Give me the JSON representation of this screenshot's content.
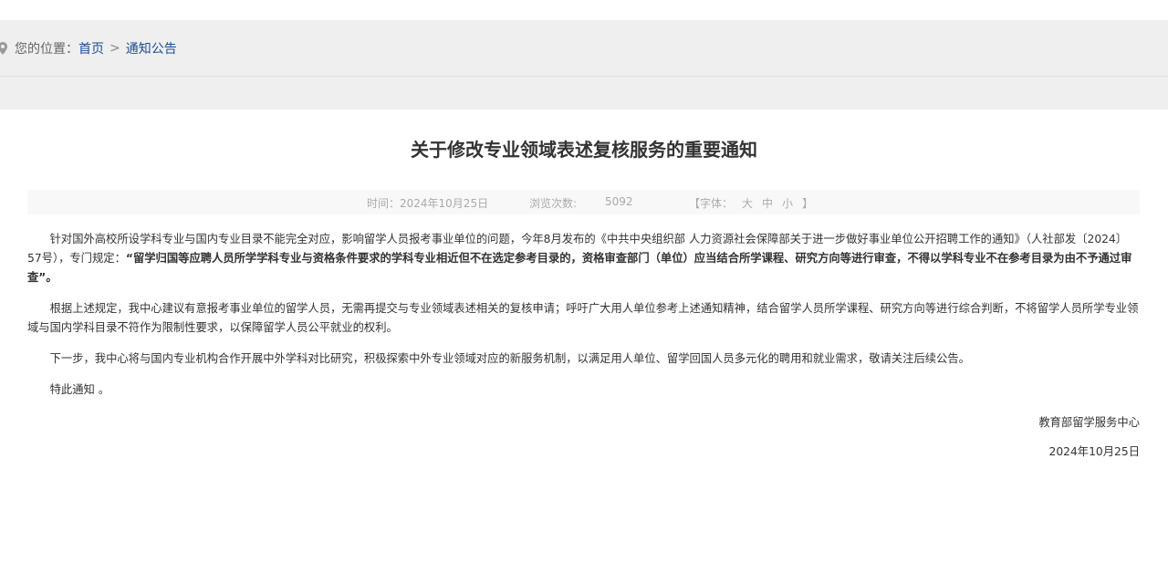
{
  "breadcrumb": {
    "prefix": "您的位置：",
    "home": "首页",
    "separator": ">",
    "current": "通知公告"
  },
  "icons": {
    "location": "location-pin-icon"
  },
  "article": {
    "title": "关于修改专业领域表述复核服务的重要通知",
    "meta": {
      "time": "时间：2024年10月25日",
      "views_label": "浏览次数:",
      "views_value": "5092",
      "font_open": "【字体：",
      "font_large": "大",
      "font_medium": "中",
      "font_small": "小",
      "font_close": "】"
    },
    "p1_plain": "针对国外高校所设学科专业与国内专业目录不能完全对应，影响留学人员报考事业单位的问题，今年8月发布的《中共中央组织部 人力资源社会保障部关于进一步做好事业单位公开招聘工作的通知》（人社部发〔2024〕57号），专门规定：",
    "p1_bold": "“留学归国等应聘人员所学学科专业与资格条件要求的学科专业相近但不在选定参考目录的，资格审查部门（单位）应当结合所学课程、研究方向等进行审查，不得以学科专业不在参考目录为由不予通过审查”",
    "p1_end": "。",
    "p2": "根据上述规定，我中心建议有意报考事业单位的留学人员，无需再提交与专业领域表述相关的复核申请；呼吁广大用人单位参考上述通知精神，结合留学人员所学课程、研究方向等进行综合判断，不将留学人员所学专业领域与国内学科目录不符作为限制性要求，以保障留学人员公平就业的权利。",
    "p3": "下一步，我中心将与国内专业机构合作开展中外学科对比研究，积极探索中外专业领域对应的新服务机制，以满足用人单位、留学回国人员多元化的聘用和就业需求，敬请关注后续公告。",
    "p4": "特此通知 。",
    "signature_org": "教育部留学服务中心",
    "signature_date": "2024年10月25日"
  },
  "colors": {
    "link": "#1f4e8c",
    "band": "#efefef",
    "meta_bg": "#f8f8f8",
    "text": "#333333"
  }
}
